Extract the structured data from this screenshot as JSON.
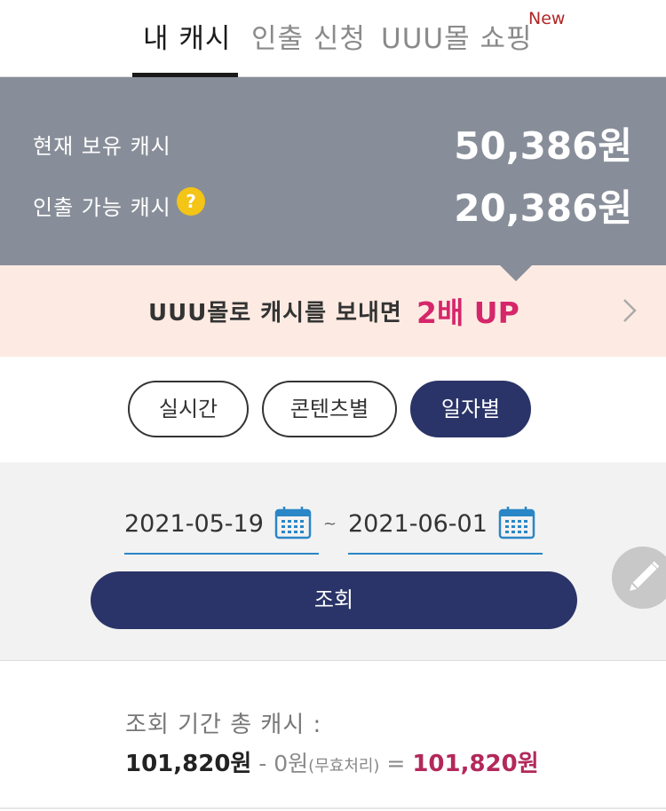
{
  "tabs": [
    {
      "label": "내 캐시",
      "active": true
    },
    {
      "label": "인출 신청",
      "active": false
    },
    {
      "label": "UUU몰 쇼핑",
      "active": false
    }
  ],
  "tab_badge": "New",
  "balance": {
    "current_label": "현재 보유 캐시",
    "current_value": "50,386원",
    "withdrawable_label": "인출 가능 캐시",
    "withdrawable_value": "20,386원",
    "help_icon_text": "?"
  },
  "promo": {
    "text": "UUU몰로 캐시를 보내면",
    "highlight": "2배 UP"
  },
  "filters": [
    {
      "label": "실시간",
      "active": false
    },
    {
      "label": "콘텐츠별",
      "active": false
    },
    {
      "label": "일자별",
      "active": true
    }
  ],
  "date_range": {
    "start": "2021-05-19",
    "separator": "~",
    "end": "2021-06-01"
  },
  "search_button": "조회",
  "summary": {
    "label": "조회 기간 총 캐시 :",
    "total": "101,820원",
    "minus": " - 0원",
    "note": "(무효처리)",
    "equals": " = ",
    "result": "101,820원"
  },
  "colors": {
    "accent_navy": "#2b3468",
    "balance_bg": "#888e99",
    "promo_bg": "#fdebe3",
    "highlight_pink": "#d6266b",
    "help_yellow": "#f4c416",
    "date_underline": "#2a86c6"
  },
  "icons": {
    "help": "question-mark-circle-icon",
    "chevron": "chevron-right-icon",
    "calendar": "calendar-icon",
    "edit": "pencil-icon"
  }
}
